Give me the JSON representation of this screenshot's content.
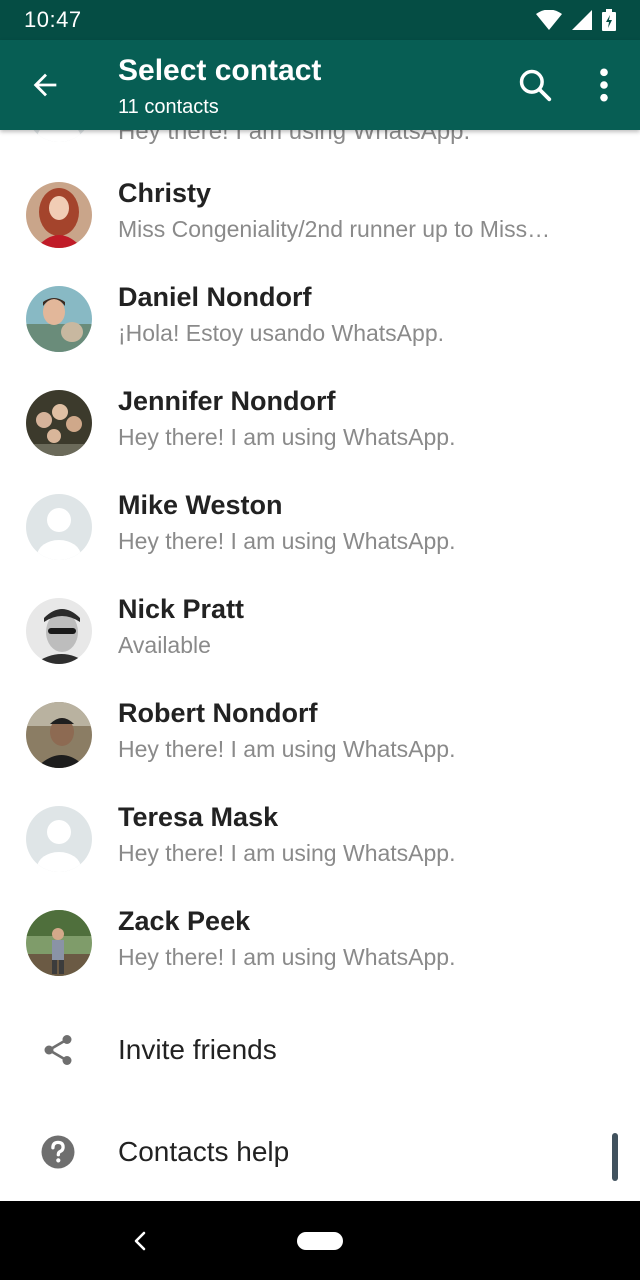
{
  "status_bar": {
    "time": "10:47",
    "icons": [
      "wifi-icon",
      "signal-icon",
      "battery-charging-icon"
    ]
  },
  "app_bar": {
    "title": "Select contact",
    "subtitle": "11 contacts",
    "back_icon": "arrow-left-icon",
    "search_icon": "search-icon",
    "more_icon": "more-vert-icon",
    "color": "#075e54"
  },
  "partial_contact": {
    "status": "Hey there! I am using WhatsApp."
  },
  "contacts": [
    {
      "name": "Christy",
      "status": "Miss Congeniality/2nd runner up to Miss…",
      "avatar": "photo"
    },
    {
      "name": "Daniel Nondorf",
      "status": "¡Hola! Estoy usando WhatsApp.",
      "avatar": "photo"
    },
    {
      "name": "Jennifer Nondorf",
      "status": "Hey there! I am using WhatsApp.",
      "avatar": "photo"
    },
    {
      "name": "Mike Weston",
      "status": "Hey there! I am using WhatsApp.",
      "avatar": "default-avatar-icon"
    },
    {
      "name": "Nick Pratt",
      "status": "Available",
      "avatar": "photo"
    },
    {
      "name": "Robert Nondorf",
      "status": "Hey there! I am using WhatsApp.",
      "avatar": "photo"
    },
    {
      "name": "Teresa Mask",
      "status": "Hey there! I am using WhatsApp.",
      "avatar": "default-avatar-icon"
    },
    {
      "name": "Zack Peek",
      "status": "Hey there! I am using WhatsApp.",
      "avatar": "photo"
    }
  ],
  "actions": [
    {
      "label": "Invite friends",
      "icon": "share-icon"
    },
    {
      "label": "Contacts help",
      "icon": "help-icon"
    }
  ],
  "nav_bar": {
    "back_icon": "nav-back-icon",
    "home_icon": "home-pill-icon"
  }
}
